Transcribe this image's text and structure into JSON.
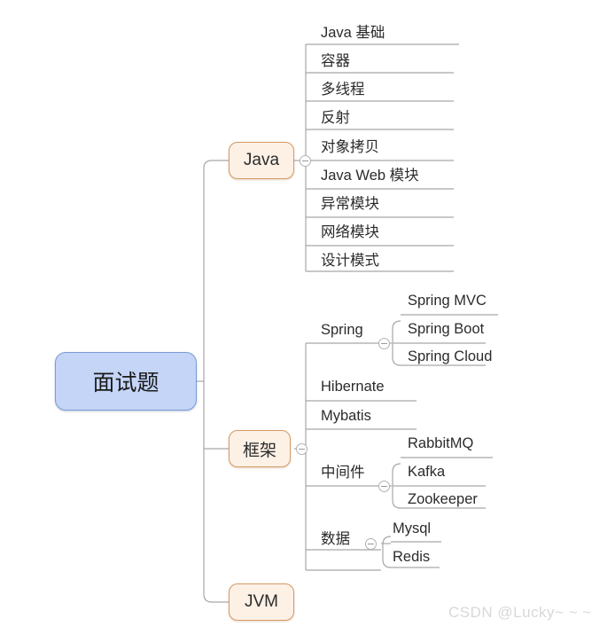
{
  "diagram": {
    "title": "面试题",
    "watermark": "CSDN @Lucky~ ~ ~",
    "colors": {
      "root_fill": "#c5d5f7",
      "root_border": "#7a9ad6",
      "branch_fill": "#fdf1e6",
      "branch_border": "#d79a63",
      "connector": "#a6a6a6",
      "text": "#2b2b2b",
      "watermark": "#d8d8d8",
      "background": "#ffffff"
    },
    "root": {
      "label": "面试题",
      "branches": [
        {
          "label": "Java",
          "collapsible": true,
          "children": [
            {
              "label": "Java 基础"
            },
            {
              "label": "容器"
            },
            {
              "label": "多线程"
            },
            {
              "label": "反射"
            },
            {
              "label": "对象拷贝"
            },
            {
              "label": "Java Web 模块"
            },
            {
              "label": "异常模块"
            },
            {
              "label": "网络模块"
            },
            {
              "label": "设计模式"
            }
          ]
        },
        {
          "label": "框架",
          "collapsible": true,
          "children": [
            {
              "label": "Spring",
              "collapsible": true,
              "children": [
                {
                  "label": "Spring MVC"
                },
                {
                  "label": "Spring Boot"
                },
                {
                  "label": "Spring Cloud"
                }
              ]
            },
            {
              "label": "Hibernate"
            },
            {
              "label": "Mybatis"
            },
            {
              "label": "中间件",
              "collapsible": true,
              "children": [
                {
                  "label": "RabbitMQ"
                },
                {
                  "label": "Kafka"
                },
                {
                  "label": "Zookeeper"
                }
              ]
            },
            {
              "label": "数据",
              "collapsible": true,
              "children": [
                {
                  "label": "Mysql"
                },
                {
                  "label": "Redis"
                }
              ]
            }
          ]
        },
        {
          "label": "JVM",
          "collapsible": false,
          "children": []
        }
      ]
    }
  }
}
